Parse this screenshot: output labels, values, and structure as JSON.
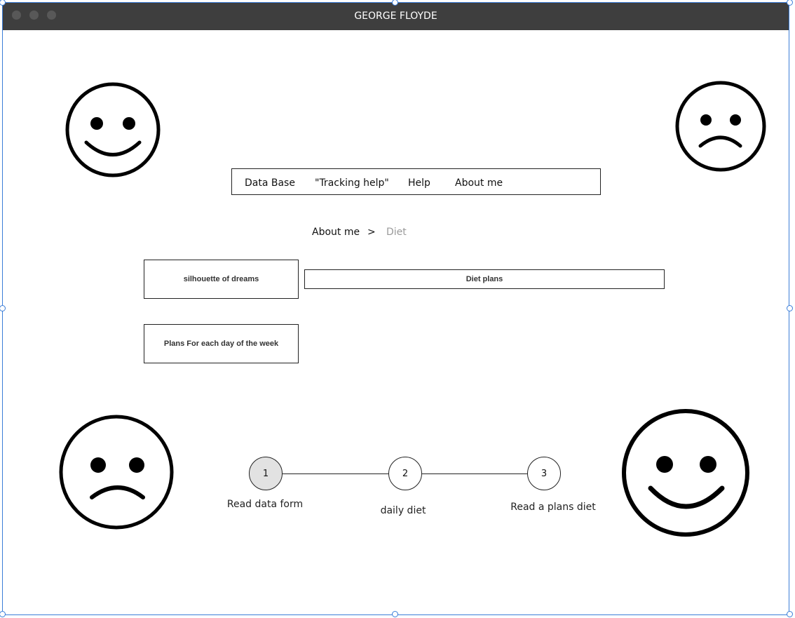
{
  "window": {
    "title": "GEORGE FLOYDE",
    "accent_color": "#3b7ed8",
    "titlebar_color": "#3e3e3e"
  },
  "menu": {
    "items": [
      "Data Base",
      "\"Tracking help\"",
      "Help",
      "About me"
    ]
  },
  "breadcrumb": {
    "parent": "About me",
    "separator": ">",
    "current": "Diet"
  },
  "buttons": {
    "silhouette": "silhouette of dreams",
    "diet_plans": "Diet plans",
    "weekly_plans": "Plans For each day of the week"
  },
  "stepper": {
    "steps": [
      {
        "number": "1",
        "label": "Read data form",
        "active": true
      },
      {
        "number": "2",
        "label": "daily diet",
        "active": false
      },
      {
        "number": "3",
        "label": "Read a plans diet",
        "active": false
      }
    ]
  },
  "icons": {
    "top_left": "happy-face-icon",
    "top_right": "sad-face-icon",
    "bottom_left": "sad-face-icon",
    "bottom_right": "happy-face-icon"
  }
}
